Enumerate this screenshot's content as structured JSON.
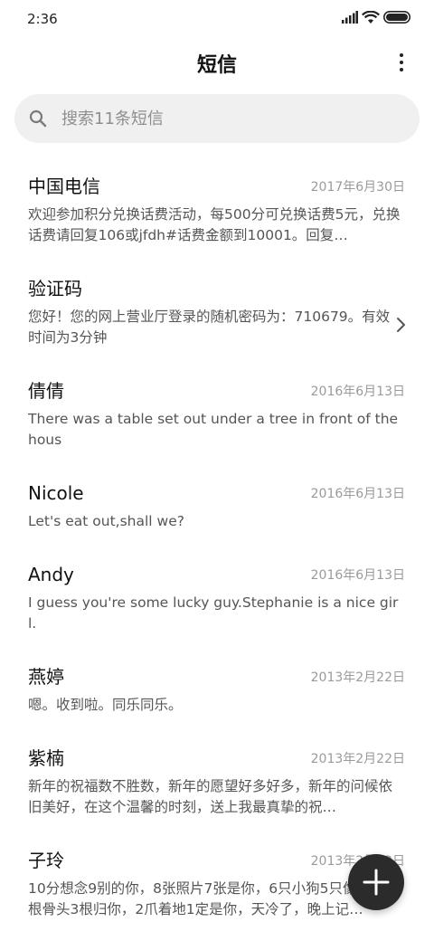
{
  "status_bar": {
    "time": "2:36",
    "icons": [
      "signal-icon",
      "wifi-icon",
      "battery-icon"
    ]
  },
  "header": {
    "title": "短信",
    "more_icon": "more-vertical-icon"
  },
  "search": {
    "placeholder": "搜索11条短信",
    "value": "",
    "icon": "search-icon"
  },
  "threads": [
    {
      "name": "中国电信",
      "date": "2017年6月30日",
      "preview": "欢迎参加积分兑换话费活动，每500分可兑换话费5元，兑换话费请回复106或jfdh#话费金额到10001。回复…"
    },
    {
      "name": "验证码",
      "date": "",
      "preview": "您好！您的网上营业厅登录的随机密码为：710679。有效时间为3分钟",
      "icon": "chevron-right-icon"
    },
    {
      "name": "倩倩",
      "date": "2016年6月13日",
      "preview": "There was a table set out under a tree in front of the hous"
    },
    {
      "name": "Nicole",
      "date": "2016年6月13日",
      "preview": "Let's eat out,shall we?"
    },
    {
      "name": "Andy",
      "date": "2016年6月13日",
      "preview": "I guess you're some lucky guy.Stephanie is a nice girl."
    },
    {
      "name": "燕婷",
      "date": "2013年2月22日",
      "preview": "嗯。收到啦。同乐同乐。"
    },
    {
      "name": "紫楠",
      "date": "2013年2月22日",
      "preview": "新年的祝福数不胜数，新年的愿望好多好多，新年的问候依旧美好，在这个温馨的时刻，送上我最真挚的祝…"
    },
    {
      "name": "子玲",
      "date": "2013年2月22日",
      "preview": "10分想念9别的你，8张照片7张是你，6只小狗5只像你，4根骨头3根归你，2爪着地1定是你，天冷了，晚上记…"
    }
  ],
  "fab": {
    "icon": "plus-icon"
  }
}
